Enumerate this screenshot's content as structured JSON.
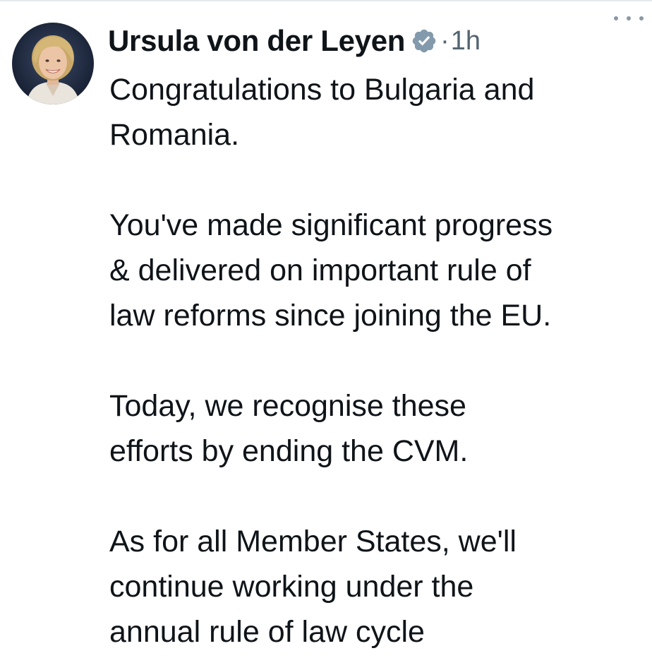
{
  "author": {
    "name": "Ursula von der Leyen",
    "verified_icon": "verified-badge-icon",
    "separator": "·",
    "time": "1h"
  },
  "more_icon": "more-horizontal-icon",
  "tweet": {
    "paragraphs": [
      {
        "lines": [
          "Congratulations to Bulgaria and",
          "Romania."
        ]
      },
      {
        "lines": [
          "You've made significant progress",
          "& delivered on important rule of",
          "law reforms since joining the EU."
        ]
      },
      {
        "lines": [
          "Today, we recognise these",
          "efforts by ending the CVM."
        ]
      },
      {
        "lines": [
          "As for all Member States, we'll",
          "continue working under the",
          "annual rule of law cycle"
        ]
      }
    ]
  },
  "colors": {
    "text": "#0f1419",
    "secondary": "#536471",
    "badge": "#829aab"
  }
}
